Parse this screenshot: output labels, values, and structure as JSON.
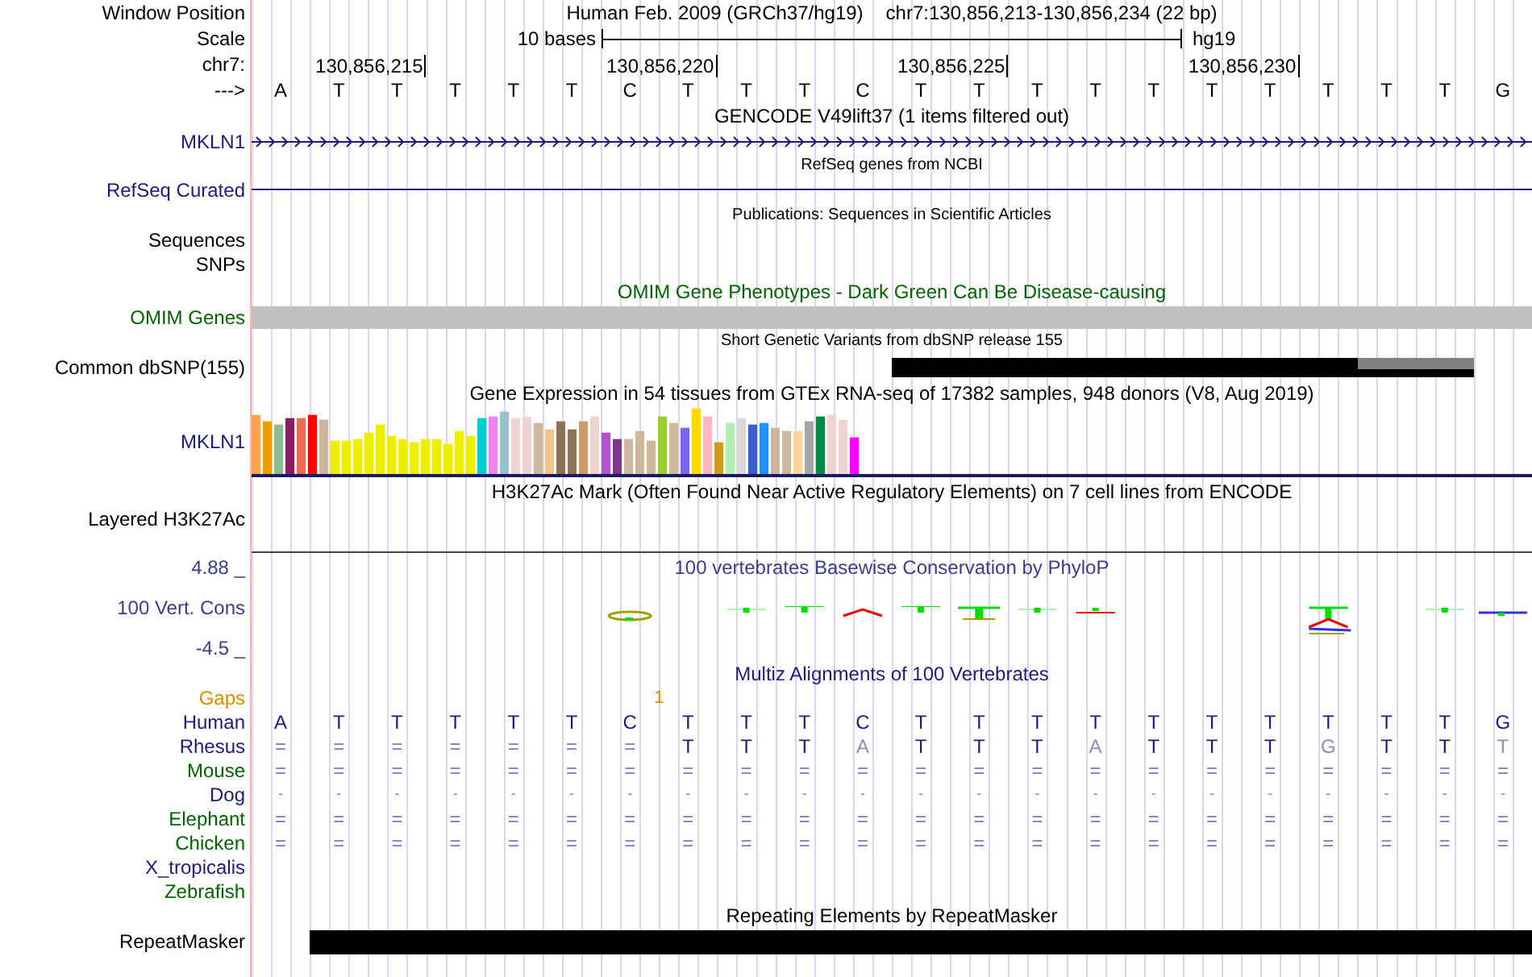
{
  "header": {
    "assembly": "Human Feb. 2009 (GRCh37/hg19)",
    "position": "chr7:130,856,213-130,856,234 (22 bp)"
  },
  "labels": {
    "window_position": "Window Position",
    "scale": "Scale",
    "chromosome": "chr7:",
    "strand": "--->"
  },
  "scale": {
    "text": "10 bases",
    "assembly": "hg19"
  },
  "ticks": [
    "130,856,215",
    "130,856,220",
    "130,856,225",
    "130,856,230"
  ],
  "bases": [
    "A",
    "T",
    "T",
    "T",
    "T",
    "T",
    "C",
    "T",
    "T",
    "T",
    "C",
    "T",
    "T",
    "T",
    "T",
    "T",
    "T",
    "T",
    "T",
    "T",
    "T",
    "G"
  ],
  "gencode": {
    "title": "GENCODE V49lift37 (1 items filtered out)",
    "label": "MKLN1"
  },
  "refseq": {
    "title": "RefSeq genes from NCBI",
    "label": "RefSeq Curated"
  },
  "publications": {
    "title": "Publications: Sequences in Scientific Articles"
  },
  "sequences": {
    "label": "Sequences"
  },
  "snps": {
    "label": "SNPs"
  },
  "omim": {
    "title": "OMIM Gene Phenotypes - Dark Green Can Be Disease-causing",
    "label": "OMIM Genes"
  },
  "dbsnp": {
    "title": "Short Genetic Variants from dbSNP release 155",
    "label": "Common dbSNP(155)"
  },
  "gtex": {
    "title": "Gene Expression in 54 tissues from GTEx RNA-seq of 17382 samples, 948 donors (V8, Aug 2019)",
    "label": "MKLN1"
  },
  "h3k27ac": {
    "title": "H3K27Ac Mark (Often Found Near Active Regulatory Elements) on 7 cell lines from ENCODE",
    "label": "Layered H3K27Ac"
  },
  "conservation": {
    "title": "100 vertebrates Basewise Conservation by PhyloP",
    "max": "4.88 _",
    "label": "100 Vert. Cons",
    "min": "-4.5 _"
  },
  "multiz": {
    "title": "Multiz Alignments of 100 Vertebrates",
    "gaps_label": "Gaps",
    "gaps": [
      "1"
    ],
    "species": [
      {
        "name": "Human",
        "color": "#1a1a80",
        "cells": [
          {
            "text": "A",
            "kind": "base"
          },
          {
            "text": "T",
            "kind": "base"
          },
          {
            "text": "T",
            "kind": "base"
          },
          {
            "text": "T",
            "kind": "base"
          },
          {
            "text": "T",
            "kind": "base"
          },
          {
            "text": "T",
            "kind": "base"
          },
          {
            "text": "C",
            "kind": "base"
          },
          {
            "text": "T",
            "kind": "base"
          },
          {
            "text": "T",
            "kind": "base"
          },
          {
            "text": "T",
            "kind": "base"
          },
          {
            "text": "C",
            "kind": "base"
          },
          {
            "text": "T",
            "kind": "base"
          },
          {
            "text": "T",
            "kind": "base"
          },
          {
            "text": "T",
            "kind": "base"
          },
          {
            "text": "T",
            "kind": "base"
          },
          {
            "text": "T",
            "kind": "base"
          },
          {
            "text": "T",
            "kind": "base"
          },
          {
            "text": "T",
            "kind": "base"
          },
          {
            "text": "T",
            "kind": "base"
          },
          {
            "text": "T",
            "kind": "base"
          },
          {
            "text": "T",
            "kind": "base"
          },
          {
            "text": "G",
            "kind": "base"
          }
        ]
      },
      {
        "name": "Rhesus",
        "color": "#1a1a80",
        "cells": [
          {
            "text": "=",
            "kind": "match"
          },
          {
            "text": "=",
            "kind": "match"
          },
          {
            "text": "=",
            "kind": "match"
          },
          {
            "text": "=",
            "kind": "match"
          },
          {
            "text": "=",
            "kind": "match"
          },
          {
            "text": "=",
            "kind": "match"
          },
          {
            "text": "=",
            "kind": "match"
          },
          {
            "text": "T",
            "kind": "base"
          },
          {
            "text": "T",
            "kind": "base"
          },
          {
            "text": "T",
            "kind": "base"
          },
          {
            "text": "A",
            "kind": "mismatch"
          },
          {
            "text": "T",
            "kind": "base"
          },
          {
            "text": "T",
            "kind": "base"
          },
          {
            "text": "T",
            "kind": "base"
          },
          {
            "text": "A",
            "kind": "mismatch"
          },
          {
            "text": "T",
            "kind": "base"
          },
          {
            "text": "T",
            "kind": "base"
          },
          {
            "text": "T",
            "kind": "base"
          },
          {
            "text": "G",
            "kind": "mismatch"
          },
          {
            "text": "T",
            "kind": "base"
          },
          {
            "text": "T",
            "kind": "base"
          },
          {
            "text": "T",
            "kind": "mismatch"
          }
        ]
      },
      {
        "name": "Mouse",
        "color": "#006400",
        "cells": [
          {
            "text": "=",
            "kind": "match"
          },
          {
            "text": "=",
            "kind": "match"
          },
          {
            "text": "=",
            "kind": "match"
          },
          {
            "text": "=",
            "kind": "match"
          },
          {
            "text": "=",
            "kind": "match"
          },
          {
            "text": "=",
            "kind": "match"
          },
          {
            "text": "=",
            "kind": "match"
          },
          {
            "text": "=",
            "kind": "match"
          },
          {
            "text": "=",
            "kind": "match"
          },
          {
            "text": "=",
            "kind": "match"
          },
          {
            "text": "=",
            "kind": "match"
          },
          {
            "text": "=",
            "kind": "match"
          },
          {
            "text": "=",
            "kind": "match"
          },
          {
            "text": "=",
            "kind": "match"
          },
          {
            "text": "=",
            "kind": "match"
          },
          {
            "text": "=",
            "kind": "match"
          },
          {
            "text": "=",
            "kind": "match"
          },
          {
            "text": "=",
            "kind": "match"
          },
          {
            "text": "=",
            "kind": "match"
          },
          {
            "text": "=",
            "kind": "match"
          },
          {
            "text": "=",
            "kind": "match"
          },
          {
            "text": "=",
            "kind": "match"
          }
        ]
      },
      {
        "name": "Dog",
        "color": "#1a1a80",
        "cells": [
          {
            "text": "-",
            "kind": "gap"
          },
          {
            "text": "-",
            "kind": "gap"
          },
          {
            "text": "-",
            "kind": "gap"
          },
          {
            "text": "-",
            "kind": "gap"
          },
          {
            "text": "-",
            "kind": "gap"
          },
          {
            "text": "-",
            "kind": "gap"
          },
          {
            "text": "-",
            "kind": "gap"
          },
          {
            "text": "-",
            "kind": "gap"
          },
          {
            "text": "-",
            "kind": "gap"
          },
          {
            "text": "-",
            "kind": "gap"
          },
          {
            "text": "-",
            "kind": "gap"
          },
          {
            "text": "-",
            "kind": "gap"
          },
          {
            "text": "-",
            "kind": "gap"
          },
          {
            "text": "-",
            "kind": "gap"
          },
          {
            "text": "-",
            "kind": "gap"
          },
          {
            "text": "-",
            "kind": "gap"
          },
          {
            "text": "-",
            "kind": "gap"
          },
          {
            "text": "-",
            "kind": "gap"
          },
          {
            "text": "-",
            "kind": "gap"
          },
          {
            "text": "-",
            "kind": "gap"
          },
          {
            "text": "-",
            "kind": "gap"
          },
          {
            "text": "-",
            "kind": "gap"
          }
        ]
      },
      {
        "name": "Elephant",
        "color": "#006400",
        "cells": [
          {
            "text": "=",
            "kind": "match"
          },
          {
            "text": "=",
            "kind": "match"
          },
          {
            "text": "=",
            "kind": "match"
          },
          {
            "text": "=",
            "kind": "match"
          },
          {
            "text": "=",
            "kind": "match"
          },
          {
            "text": "=",
            "kind": "match"
          },
          {
            "text": "=",
            "kind": "match"
          },
          {
            "text": "=",
            "kind": "match"
          },
          {
            "text": "=",
            "kind": "match"
          },
          {
            "text": "=",
            "kind": "match"
          },
          {
            "text": "=",
            "kind": "match"
          },
          {
            "text": "=",
            "kind": "match"
          },
          {
            "text": "=",
            "kind": "match"
          },
          {
            "text": "=",
            "kind": "match"
          },
          {
            "text": "=",
            "kind": "match"
          },
          {
            "text": "=",
            "kind": "match"
          },
          {
            "text": "=",
            "kind": "match"
          },
          {
            "text": "=",
            "kind": "match"
          },
          {
            "text": "=",
            "kind": "match"
          },
          {
            "text": "=",
            "kind": "match"
          },
          {
            "text": "=",
            "kind": "match"
          },
          {
            "text": "=",
            "kind": "match"
          }
        ]
      },
      {
        "name": "Chicken",
        "color": "#006400",
        "cells": [
          {
            "text": "=",
            "kind": "match"
          },
          {
            "text": "=",
            "kind": "match"
          },
          {
            "text": "=",
            "kind": "match"
          },
          {
            "text": "=",
            "kind": "match"
          },
          {
            "text": "=",
            "kind": "match"
          },
          {
            "text": "=",
            "kind": "match"
          },
          {
            "text": "=",
            "kind": "match"
          },
          {
            "text": "=",
            "kind": "match"
          },
          {
            "text": "=",
            "kind": "match"
          },
          {
            "text": "=",
            "kind": "match"
          },
          {
            "text": "=",
            "kind": "match"
          },
          {
            "text": "=",
            "kind": "match"
          },
          {
            "text": "=",
            "kind": "match"
          },
          {
            "text": "=",
            "kind": "match"
          },
          {
            "text": "=",
            "kind": "match"
          },
          {
            "text": "=",
            "kind": "match"
          },
          {
            "text": "=",
            "kind": "match"
          },
          {
            "text": "=",
            "kind": "match"
          },
          {
            "text": "=",
            "kind": "match"
          },
          {
            "text": "=",
            "kind": "match"
          },
          {
            "text": "=",
            "kind": "match"
          },
          {
            "text": "=",
            "kind": "match"
          }
        ]
      },
      {
        "name": "X_tropicalis",
        "color": "#1a1a80"
      },
      {
        "name": "Zebrafish",
        "color": "#006400"
      }
    ]
  },
  "repeatmasker": {
    "title": "Repeating Elements by RepeatMasker",
    "label": "RepeatMasker"
  }
}
